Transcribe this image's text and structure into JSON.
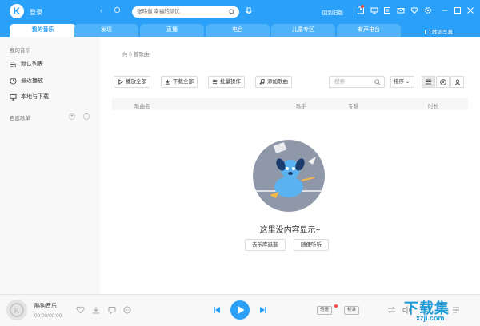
{
  "header": {
    "login": "登录",
    "search_placeholder": "张玮伽 幸福的顽忧",
    "old_version": "回到旧版"
  },
  "tabs": [
    {
      "label": "我的音乐",
      "active": true
    },
    {
      "label": "发现"
    },
    {
      "label": "直播"
    },
    {
      "label": "电台"
    },
    {
      "label": "儿童专区"
    },
    {
      "label": "有声电台"
    }
  ],
  "lyrics_label": "歌词写真",
  "sidebar": {
    "my_music": "我的音乐",
    "items": [
      {
        "label": "默认列表",
        "icon": "playlist-icon"
      },
      {
        "label": "最近播放",
        "icon": "clock-icon"
      },
      {
        "label": "本地与下载",
        "icon": "monitor-icon"
      }
    ],
    "created_lists": "自建歌单"
  },
  "main": {
    "count": "共 0 首歌曲",
    "actions": [
      "播放全部",
      "下载全部",
      "批量操作",
      "添加歌曲"
    ],
    "search_placeholder": "搜索",
    "sort": "排序",
    "columns": [
      "歌曲名",
      "歌手",
      "专辑",
      "时长"
    ],
    "empty_text": "这里没内容显示~",
    "empty_buttons": [
      "去乐库逛逛",
      "随便听听"
    ]
  },
  "player": {
    "title": "酷狗音乐",
    "time": "00:00/00:00",
    "speed": "倍速",
    "quality": "标准"
  },
  "watermark": {
    "text": "下载集",
    "url": "xzji.com"
  },
  "colors": {
    "accent": "#2ba0f8"
  }
}
